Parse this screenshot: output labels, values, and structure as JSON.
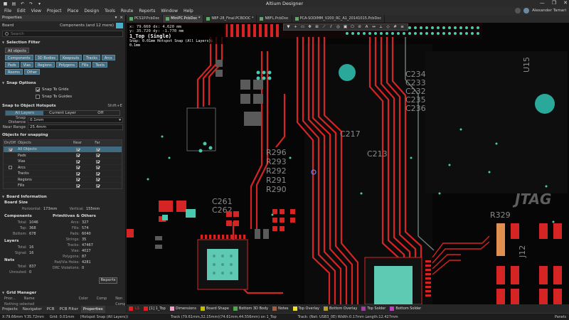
{
  "app": {
    "title": "Altium Designer",
    "quick_access": [
      "save-icon",
      "open-icon",
      "undo-icon",
      "redo-icon",
      "dropdown-icon"
    ],
    "window_controls": [
      "—",
      "❐",
      "✕"
    ]
  },
  "menu": {
    "items": [
      "File",
      "Edit",
      "View",
      "Project",
      "Place",
      "Design",
      "Tools",
      "Route",
      "Reports",
      "Window",
      "Help"
    ],
    "user_name": "Alexander Tamari"
  },
  "properties": {
    "panel_title": "Properties",
    "board_label": "Board",
    "components_selector": "Components (and 12 more)",
    "search_placeholder": "Search",
    "selection_filter": {
      "title": "Selection Filter",
      "all_objects": "All objects",
      "chips": [
        "Components",
        "3D Bodies",
        "Keepouts",
        "Tracks",
        "Arcs",
        "Pads",
        "Vias",
        "Regions",
        "Polygons",
        "Fills",
        "Texts",
        "Rooms",
        "Other"
      ]
    },
    "snap_options": {
      "title": "Snap Options",
      "snap_to_grids": "Snap To Grids",
      "snap_to_guides": "Snap To Guides"
    },
    "snap_hotspots": {
      "title": "Snap to Object Hotspots",
      "shortcut": "Shift+E",
      "modes": [
        "All Layers",
        "Current Layer",
        "Off"
      ],
      "snap_distance_label": "Snap Distance",
      "snap_distance_value": "0.1mm",
      "near_range_label": "Near Range",
      "near_range_value": "25.4mm"
    },
    "objects_for_snapping": {
      "title": "Objects for snapping",
      "headers": [
        "On/Off",
        "Objects",
        "Near",
        "Far"
      ],
      "rows": [
        "All Objects",
        "Pads",
        "Vias",
        "Arcs",
        "Tracks",
        "Regions",
        "Fills"
      ]
    },
    "board_info": {
      "title": "Board Information",
      "board_size": "Board Size",
      "horizontal_label": "Horizontal:",
      "horizontal_value": "173mm",
      "vertical_label": "Vertical:",
      "vertical_value": "155mm",
      "components": "Components",
      "primitives": "Primitives & Others",
      "comp_rows": [
        {
          "k": "Total:",
          "v": "1046"
        },
        {
          "k": "Top:",
          "v": "368"
        },
        {
          "k": "Bottom:",
          "v": "678"
        }
      ],
      "prim_rows": [
        {
          "k": "Arcs:",
          "v": "327"
        },
        {
          "k": "Fills:",
          "v": "574"
        },
        {
          "k": "Pads:",
          "v": "6040"
        },
        {
          "k": "Strings:",
          "v": "35"
        },
        {
          "k": "Tracks:",
          "v": "47467"
        },
        {
          "k": "Vias:",
          "v": "4027"
        },
        {
          "k": "Polygons:",
          "v": "87"
        },
        {
          "k": "Pad/Via Holes:",
          "v": "4281"
        },
        {
          "k": "DRC Violations:",
          "v": "0"
        }
      ],
      "layers": "Layers",
      "layer_rows": [
        {
          "k": "Total:",
          "v": "16"
        },
        {
          "k": "Signal:",
          "v": "16"
        }
      ],
      "nets": "Nets",
      "net_rows": [
        {
          "k": "Total:",
          "v": "837"
        },
        {
          "k": "Unrouted:",
          "v": "0"
        }
      ],
      "reports_button": "Reports"
    },
    "grid_manager": {
      "title": "Grid Manager",
      "headers": [
        "Prior...",
        "Name",
        "Color",
        "Comp",
        "Non Comp"
      ],
      "empty_text": "Nothing selected"
    },
    "bottom_tabs": [
      "Projects",
      "Navigator",
      "PCB",
      "PCB Filter",
      "Properties"
    ]
  },
  "doc_tabs": [
    "PCS1P.PcbDoc",
    "MiniPC.PcbDoc *",
    "NBF-28_Final.PCBDOC *",
    "NBFL.PcbDoc",
    "PCA-SODIMM_V200_RC_A1_20141015.PcbDoc"
  ],
  "hud": {
    "line1": "x: 79.660   dx: 4.620 mm",
    "line2": "y: 35.720   dy: -1.770 mm",
    "layer": "1_Top (Single)",
    "snap": "Snap: 0.01mm Hotspot Snap (All Layers): 0.1mm"
  },
  "board_labels": {
    "r296": "R296",
    "r293": "R293",
    "r292": "R292",
    "r291": "R291",
    "r290": "R290",
    "c213": "C213",
    "c217": "C217",
    "u15": "U15",
    "r329": "R329",
    "jtag": "JTAG",
    "j12": "J12",
    "c234": "C234",
    "c233": "C233",
    "c232": "C232",
    "c235": "C235",
    "c236": "C236",
    "c261": "C261",
    "c262": "C262"
  },
  "layers": {
    "ls": "LS",
    "items": [
      {
        "name": "[1] 1_Top",
        "color": "#e02020"
      },
      {
        "name": "Dimensions",
        "color": "#f0a0c8"
      },
      {
        "name": "Board Shape",
        "color": "#c0c000"
      },
      {
        "name": "Bottom 3D Body",
        "color": "#4aa84a"
      },
      {
        "name": "Notes",
        "color": "#a06040"
      },
      {
        "name": "Top Overlay",
        "color": "#f0e030"
      },
      {
        "name": "Bottom Overlay",
        "color": "#b0a030"
      },
      {
        "name": "Top Solder",
        "color": "#a040a0"
      },
      {
        "name": "Bottom Solder",
        "color": "#c040c0"
      }
    ]
  },
  "status": {
    "coords": "X:79.66mm Y:35.72mm",
    "grid": "Grid: 0.01mm",
    "snap": "(Hotspot Snap (All Layers))",
    "track": "Track (79.61mm,32.15mm)(74.61mm,44.556mm) on 1_Top",
    "net": "Track: (Net: USB3_0E) Width:0.17mm Length:12.427mm",
    "panels": "Panels"
  }
}
